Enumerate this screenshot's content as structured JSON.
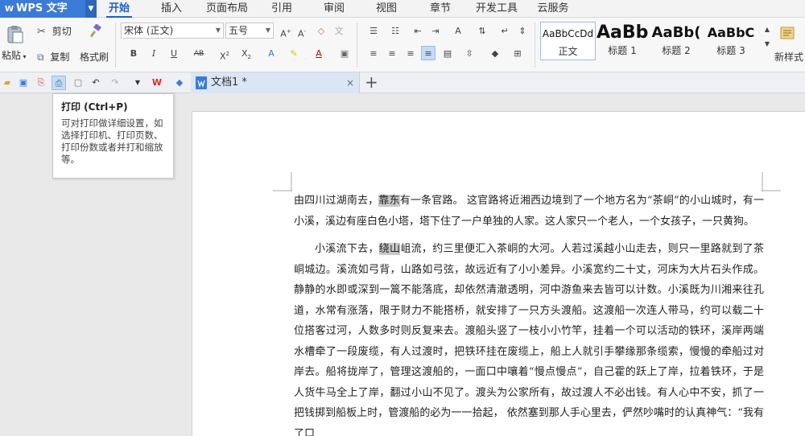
{
  "app": {
    "name": "WPS 文字"
  },
  "menu_tabs": [
    "开始",
    "插入",
    "页面布局",
    "引用",
    "审阅",
    "视图",
    "章节",
    "开发工具",
    "云服务"
  ],
  "ribbon": {
    "clipboard": {
      "paste": "粘贴",
      "cut": "剪切",
      "copy": "复制",
      "format_painter": "格式刷"
    },
    "font": {
      "name": "宋体 (正文)",
      "size": "五号"
    },
    "styles": [
      {
        "sample": "AaBbCcDd",
        "name": "正文"
      },
      {
        "sample": "AaBb",
        "name": "标题 1"
      },
      {
        "sample": "AaBb(",
        "name": "标题 2"
      },
      {
        "sample": "AaBbC",
        "name": "标题 3"
      }
    ],
    "new_style": "新样式"
  },
  "doc_tab": {
    "title": "文档1 *",
    "close": "×",
    "new": "+"
  },
  "tooltip": {
    "title": "打印 (Ctrl+P)",
    "body": "可对打印做详细设置，如选择打印机、打印页数、打印份数或者并打和缩放等。"
  },
  "document": {
    "p1_a": "由四川过湖南去，",
    "p1_hl": "靠东",
    "p1_b": "有一条官路。 这官路将近湘西边境到了一个地方名为“茶峒”的小山城时，有一小溪，溪边有座白色小塔，塔下住了一户单独的人家。这人家只一个老人，一个女孩子，一只黄狗。",
    "p2_a": "小溪流下去，",
    "p2_hl": "绕山",
    "p2_b": "岨流，约三里便汇入茶峒的大河。人若过溪越小山走去，则只一里路就到了茶峒城边。溪流如弓背，山路如弓弦，故远近有了小小差异。小溪宽约二十丈，河床为大片石头作成。静静的水即或深到一篙不能落底，却依然清澈透明，河中游鱼来去皆可以计数。小溪既为川湘来往孔道，水常有涨落，限于财力不能搭桥，就安排了一只方头渡船。这渡船一次连人带马，约可以载二十位搭客过河，人数多时则反复来去。渡船头竖了一枝小小竹竿，挂着一个可以活动的铁环，溪岸两端水槽牵了一段废缆，有人过渡时，把铁环挂在废缆上，船上人就引手攀缘那条缆索，慢慢的牵船过对岸去。船将拢岸了，管理这渡船的，一面口中嚷着“慢点慢点”，自己霍的跃上了岸，拉着铁环，于是人货牛马全上了岸，翻过小山不见了。渡头为公家所有，故过渡人不必出钱。有人心中不安，抓了一把钱掷到船板上时，管渡船的必为一一拾起， 依然塞到那人手心里去，俨然吵嘴时的认真神气：“我有了口"
  }
}
